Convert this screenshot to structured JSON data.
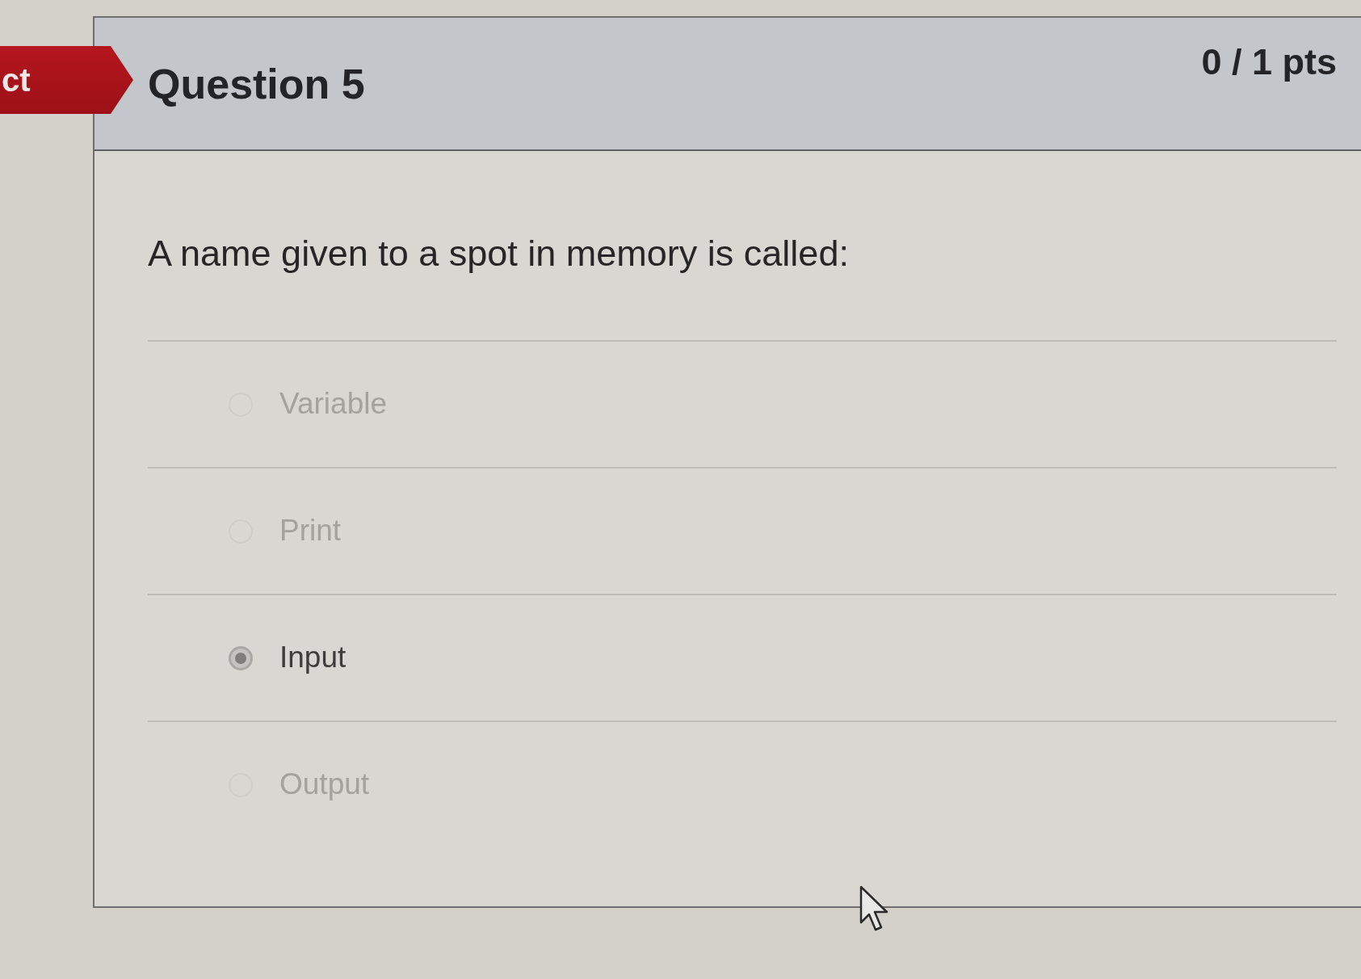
{
  "result_tag": {
    "text": "ct"
  },
  "question": {
    "title": "Question 5",
    "points": "0 / 1 pts",
    "text": "A name given to a spot in memory is called:",
    "answers": [
      {
        "label": "Variable",
        "selected": false
      },
      {
        "label": "Print",
        "selected": false
      },
      {
        "label": "Input",
        "selected": true
      },
      {
        "label": "Output",
        "selected": false
      }
    ]
  }
}
